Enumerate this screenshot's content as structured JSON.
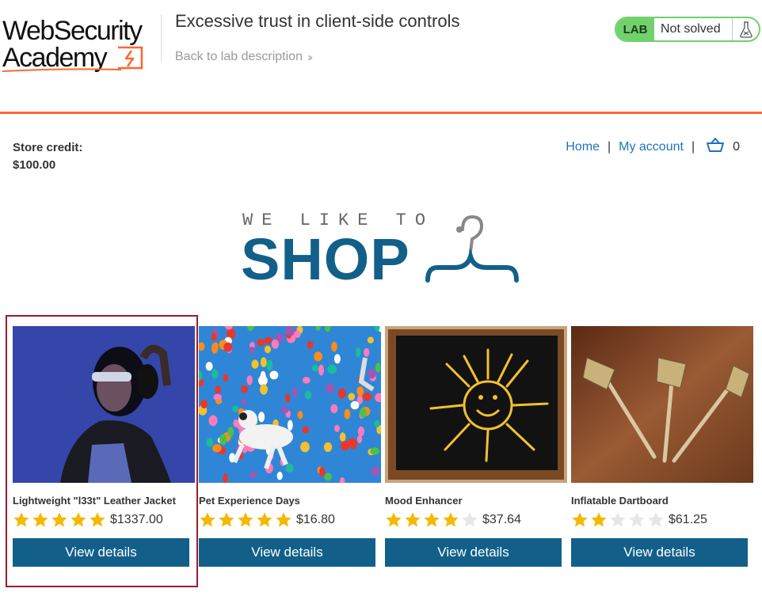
{
  "header": {
    "logo_line1": "WebSecurity",
    "logo_line2": "Academy",
    "lab_title": "Excessive trust in client-side controls",
    "back_link": "Back to lab description",
    "lab_badge": "LAB",
    "lab_status": "Not solved",
    "accent_color": "#ff6633",
    "status_color": "#70d16d"
  },
  "shop": {
    "store_credit_label": "Store credit:",
    "store_credit_value": "$100.00",
    "nav": {
      "home": "Home",
      "my_account": "My account",
      "cart_count": "0"
    },
    "banner_small": "WE LIKE TO",
    "banner_big": "SHOP",
    "brand_color": "#12608a"
  },
  "products": [
    {
      "name": "Lightweight \"l33t\" Leather Jacket",
      "price": "$1337.00",
      "rating": 5,
      "button": "View details",
      "image": "person-with-headphones-photo"
    },
    {
      "name": "Pet Experience Days",
      "price": "$16.80",
      "rating": 5,
      "button": "View details",
      "image": "dogs-with-balloons-photo"
    },
    {
      "name": "Mood Enhancer",
      "price": "$37.64",
      "rating": 4,
      "button": "View details",
      "image": "sun-drawing-chalkboard-photo"
    },
    {
      "name": "Inflatable Dartboard",
      "price": "$61.25",
      "rating": 2,
      "button": "View details",
      "image": "darts-photo"
    }
  ]
}
